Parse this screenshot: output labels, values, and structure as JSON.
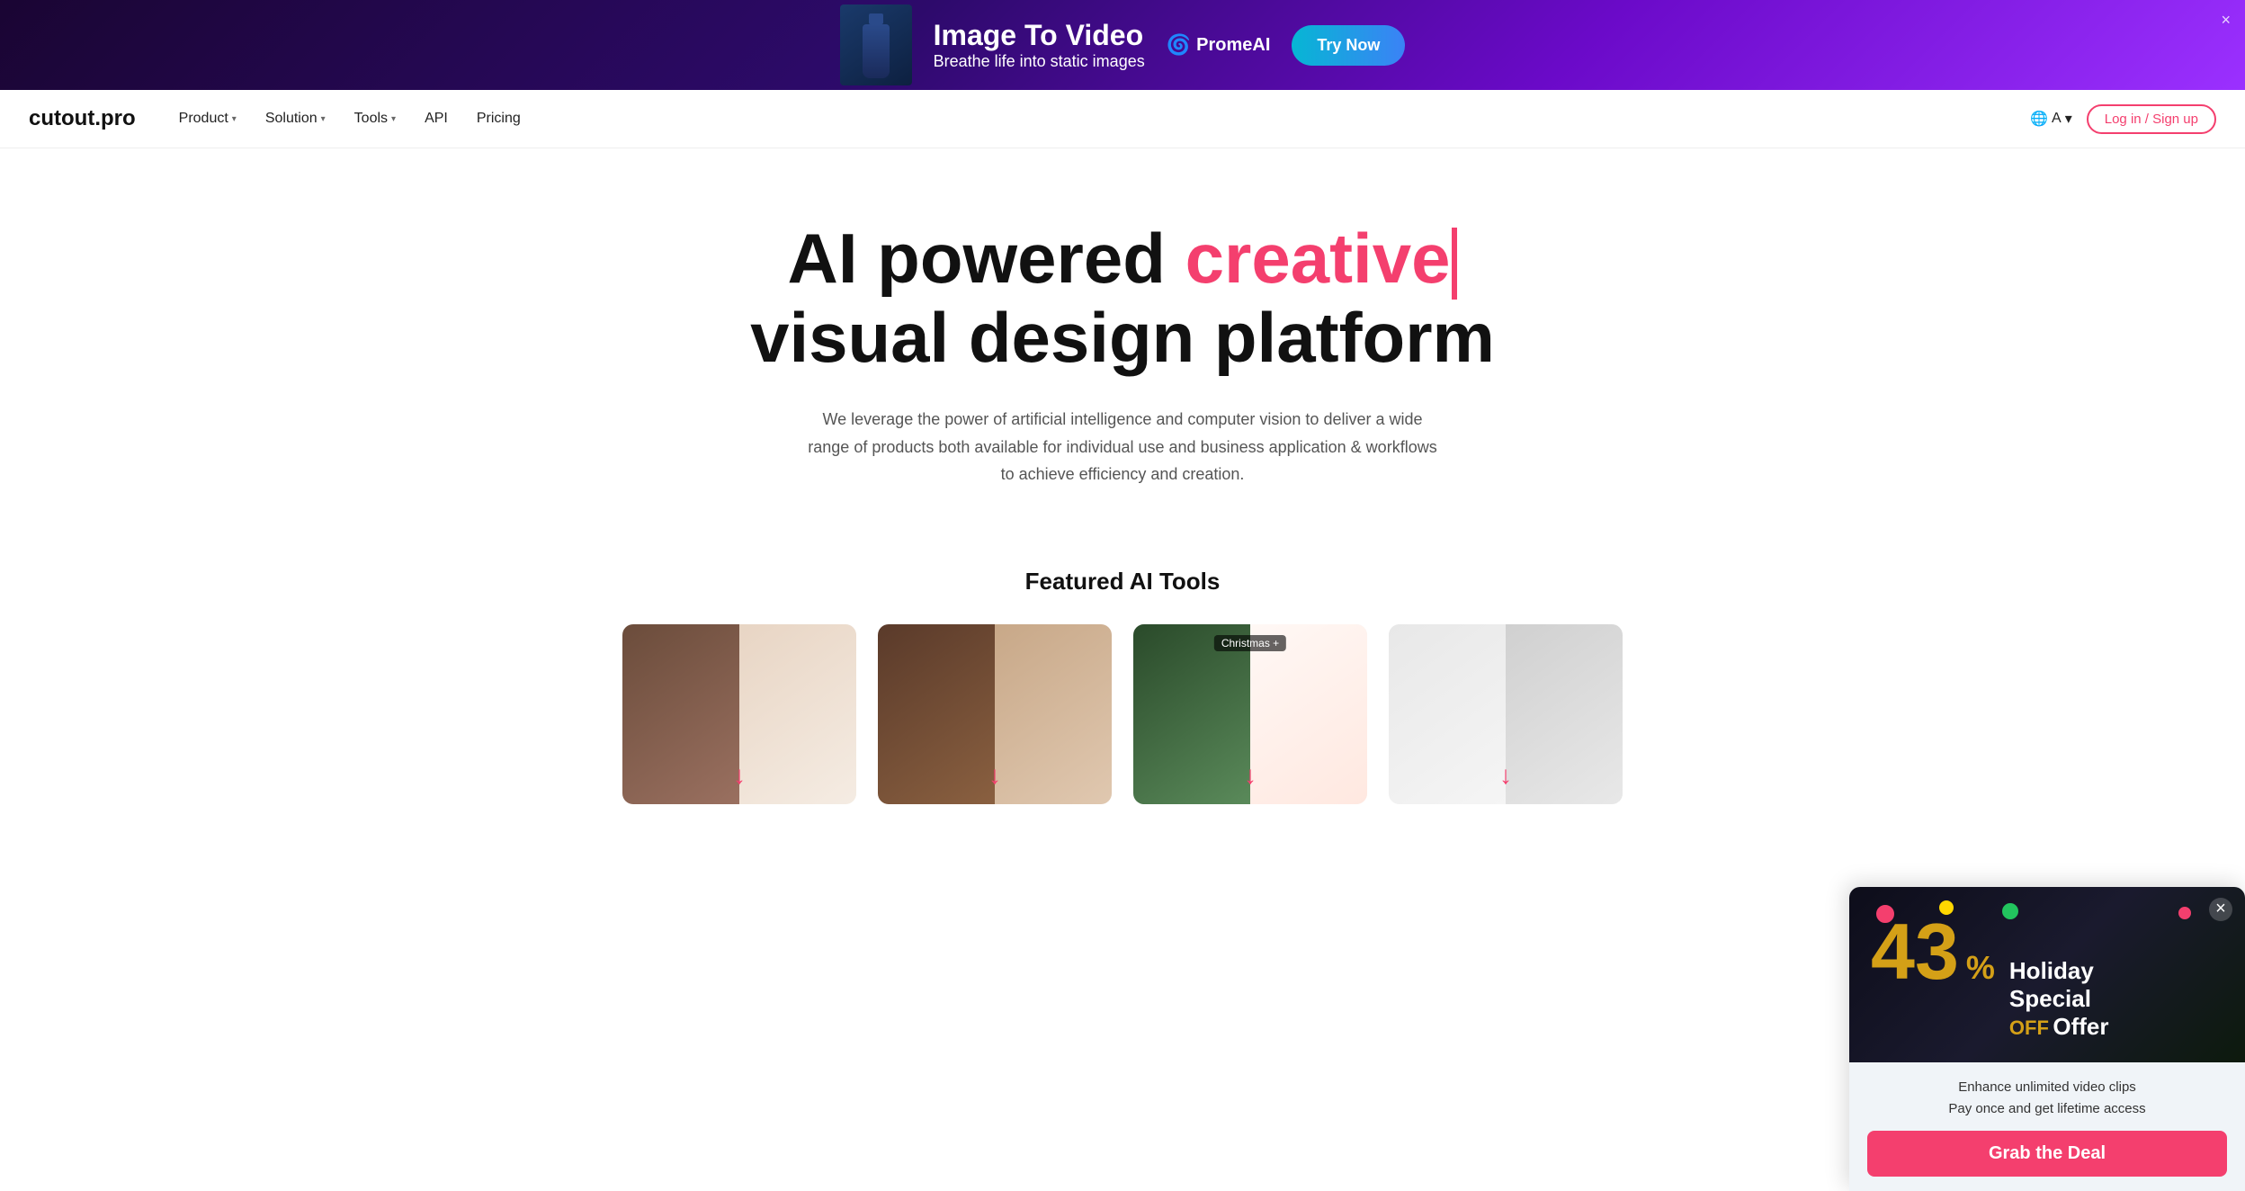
{
  "ad": {
    "title": "Image To Video",
    "subtitle": "Breathe life into static images",
    "logo": "PromeAI",
    "try_btn": "Try Now",
    "close_label": "×"
  },
  "navbar": {
    "logo": "cutout.pro",
    "product_label": "Product",
    "solution_label": "Solution",
    "tools_label": "Tools",
    "api_label": "API",
    "pricing_label": "Pricing",
    "lang_label": "A",
    "login_label": "Log in / Sign up"
  },
  "hero": {
    "title_part1": "AI powered ",
    "title_accent": "creative",
    "title_part2": "visual design platform",
    "description": "We leverage the power of artificial intelligence and computer vision to deliver a wide range of products both available for individual use and business application & workflows to achieve efficiency and creation."
  },
  "featured": {
    "section_title": "Featured AI Tools",
    "tools": [
      {
        "tag": "",
        "arrow": "↓"
      },
      {
        "tag": "",
        "arrow": "↓"
      },
      {
        "tag": "Christmas +",
        "arrow": "↓"
      },
      {
        "tag": "",
        "arrow": "↓"
      }
    ]
  },
  "popup": {
    "discount_number": "43",
    "discount_percent": "%",
    "line1": "Holiday",
    "line2": "Special",
    "off_label": "OFF",
    "offer_label": "Offer",
    "desc_line1": "Enhance unlimited video clips",
    "desc_line2": "Pay once and get lifetime access",
    "cta_label": "Grab the Deal",
    "close_label": "×"
  }
}
